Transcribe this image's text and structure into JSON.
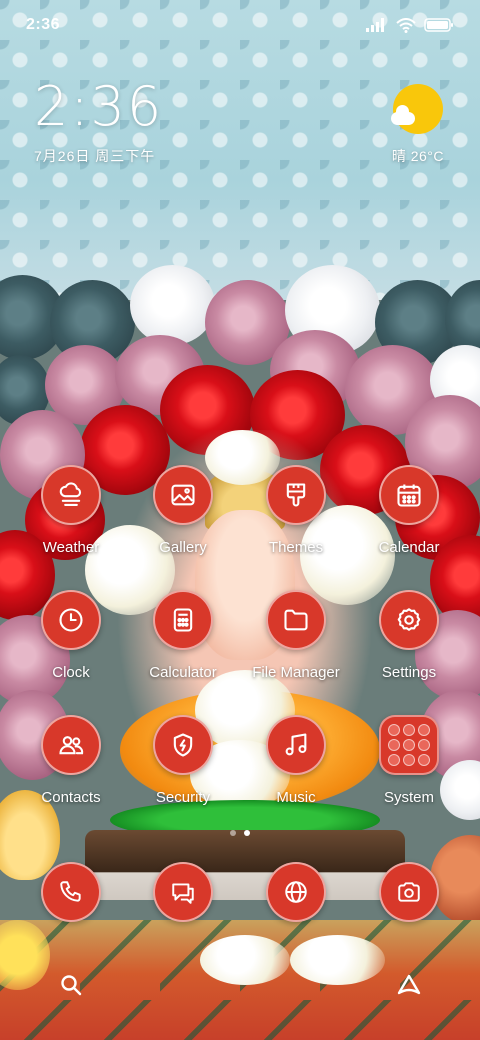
{
  "status_bar": {
    "time": "2:36",
    "icons": [
      "signal-icon",
      "wifi-icon",
      "battery-icon"
    ]
  },
  "clock_widget": {
    "time": "2:36",
    "date": "7月26日 周三下午"
  },
  "weather_widget": {
    "icon": "sun-cloud-icon",
    "text": "晴 26°C"
  },
  "home_apps": [
    {
      "label": "Weather",
      "icon": "weather-icon"
    },
    {
      "label": "Gallery",
      "icon": "gallery-icon"
    },
    {
      "label": "Themes",
      "icon": "themes-icon"
    },
    {
      "label": "Calendar",
      "icon": "calendar-icon"
    },
    {
      "label": "Clock",
      "icon": "clock-icon"
    },
    {
      "label": "Calculator",
      "icon": "calculator-icon"
    },
    {
      "label": "File Manager",
      "icon": "folder-icon"
    },
    {
      "label": "Settings",
      "icon": "gear-icon"
    },
    {
      "label": "Contacts",
      "icon": "contacts-icon"
    },
    {
      "label": "Security",
      "icon": "shield-icon"
    },
    {
      "label": "Music",
      "icon": "music-icon"
    },
    {
      "label": "System",
      "icon": "folder-grid-icon"
    }
  ],
  "page_indicator": {
    "pages": 2,
    "current": 2
  },
  "dock": [
    {
      "icon": "phone-icon"
    },
    {
      "icon": "messages-icon"
    },
    {
      "icon": "browser-icon"
    },
    {
      "icon": "camera-icon"
    }
  ],
  "bottom_bar": {
    "left_icon": "search-icon",
    "right_icon": "assistant-icon"
  },
  "colors": {
    "icon_background": "#d8382a",
    "label_text": "#ffffff",
    "sun": "#f9c70b"
  }
}
